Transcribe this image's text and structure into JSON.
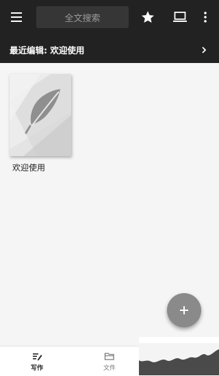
{
  "header": {
    "search_placeholder": "全文搜索",
    "icons": {
      "menu": "menu-icon",
      "favorite": "star-icon",
      "device": "laptop-icon",
      "more": "more-vert-icon"
    }
  },
  "recent": {
    "label": "最近编辑: 欢迎使用",
    "icon": "chevron-right-icon"
  },
  "notebooks": [
    {
      "title": "欢迎使用",
      "cover_icon": "feather-icon"
    }
  ],
  "fab": {
    "icon": "plus-icon"
  },
  "bottom_nav": {
    "tabs": [
      {
        "label": "写作",
        "icon": "pen-icon",
        "active": true
      },
      {
        "label": "文件",
        "icon": "folder-icon",
        "active": false
      }
    ]
  },
  "colors": {
    "topbar": "#222222",
    "search_bg": "#363636",
    "page_bg": "#f5f5f5",
    "fab": "#8a8a8a"
  }
}
